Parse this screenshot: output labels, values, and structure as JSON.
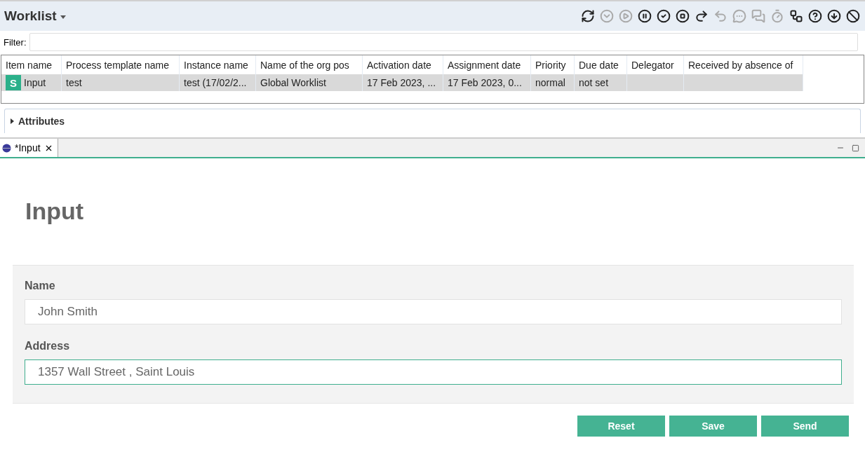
{
  "view": {
    "title": "Worklist"
  },
  "toolbar": [
    {
      "kind": "refresh",
      "disabled": false
    },
    {
      "kind": "down",
      "disabled": true
    },
    {
      "kind": "play",
      "disabled": true
    },
    {
      "kind": "pause",
      "disabled": false
    },
    {
      "kind": "check",
      "disabled": false
    },
    {
      "kind": "stop",
      "disabled": false
    },
    {
      "kind": "redo",
      "disabled": false
    },
    {
      "kind": "undo",
      "disabled": true
    },
    {
      "kind": "comment",
      "disabled": true
    },
    {
      "kind": "comments",
      "disabled": true
    },
    {
      "kind": "timer",
      "disabled": true
    },
    {
      "kind": "flow",
      "disabled": false
    },
    {
      "kind": "help",
      "disabled": false
    },
    {
      "kind": "download",
      "disabled": false
    },
    {
      "kind": "block",
      "disabled": false
    }
  ],
  "filter": {
    "label": "Filter:"
  },
  "table": {
    "columns": [
      "Item name",
      "Process template name",
      "Instance name",
      "Name of the org pos",
      "Activation date",
      "Assignment date",
      "Priority",
      "Due date",
      "Delegator",
      "Received by absence of"
    ],
    "rows": [
      {
        "selected": true,
        "icon_label": "S",
        "cells": [
          "Input",
          "test",
          "test (17/02/2...",
          "Global Worklist",
          "17 Feb 2023, ...",
          "17 Feb 2023, 0...",
          "normal",
          "not set",
          "",
          ""
        ]
      }
    ]
  },
  "attributes": {
    "label": "Attributes",
    "expanded": false
  },
  "editor_tab": {
    "label": "*Input"
  },
  "form": {
    "title": "Input",
    "fields": [
      {
        "label": "Name",
        "value": "John Smith",
        "focused": false
      },
      {
        "label": "Address",
        "value": "1357 Wall Street , Saint Louis",
        "focused": true
      }
    ],
    "buttons": [
      "Reset",
      "Save",
      "Send"
    ]
  }
}
